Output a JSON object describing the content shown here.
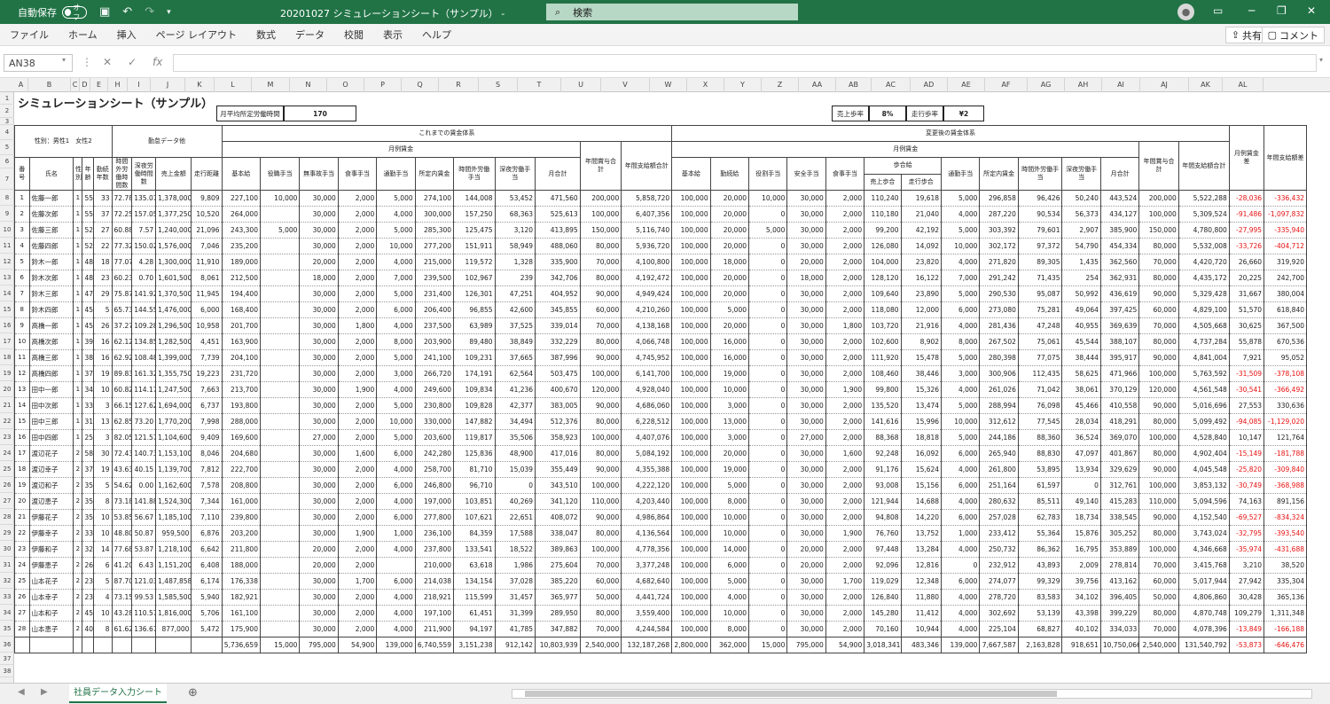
{
  "titlebar": {
    "autosave_label": "自動保存",
    "autosave_state": "オフ",
    "title": "20201027  シミュレーションシート（サンプル）  -",
    "search_placeholder": "検索"
  },
  "menu": [
    "ファイル",
    "ホーム",
    "挿入",
    "ページ レイアウト",
    "数式",
    "データ",
    "校閲",
    "表示",
    "ヘルプ"
  ],
  "share_label": "共有",
  "comment_label": "コメント",
  "namebox": "AN38",
  "columns": [
    "A",
    "B",
    "C",
    "D",
    "E",
    "H",
    "I",
    "J",
    "K",
    "L",
    "M",
    "N",
    "O",
    "P",
    "Q",
    "R",
    "S",
    "T",
    "U",
    "V",
    "W",
    "X",
    "Y",
    "Z",
    "AA",
    "AB",
    "AC",
    "AD",
    "AE",
    "AF",
    "AG",
    "AH",
    "AI",
    "AJ",
    "AK",
    "AL"
  ],
  "row_numbers": [
    "1",
    "2",
    "3",
    "4",
    "5",
    "6",
    "7",
    "8",
    "9",
    "10",
    "11",
    "12",
    "13",
    "14",
    "15",
    "16",
    "17",
    "18",
    "19",
    "20",
    "21",
    "22",
    "23",
    "24",
    "25",
    "26",
    "27",
    "28",
    "29",
    "30",
    "31",
    "32",
    "33",
    "34",
    "35",
    "36",
    "37",
    "38"
  ],
  "sheet": {
    "title": "シミュレーションシート（サンプル）",
    "monthly_hours_label": "月平均所定労働時間",
    "monthly_hours_value": "170",
    "sales_rate_label": "売上歩率",
    "sales_rate_value": "8%",
    "run_rate_label": "走行歩率",
    "run_rate_value": "¥2",
    "gender_note": "性別：男性1　女性2",
    "attendance_header": "勤怠データ他",
    "before_header": "これまでの賃金体系",
    "after_header": "変更後の賃金体系",
    "monthly_wage": "月例賃金",
    "annual_bonus": "年間賞与合計",
    "annual_pay": "年間支給額合計",
    "monthly_diff": "月例賃金差",
    "annual_diff": "年間支給額差",
    "commission": "歩合給",
    "headers_left": [
      "番号",
      "氏名",
      "性別",
      "年齢",
      "勤続年数",
      "時間外労働時間数",
      "深夜労働時間数",
      "売上金額",
      "走行距離"
    ],
    "headers_before": [
      "基本給",
      "役職手当",
      "無事故手当",
      "食事手当",
      "通勤手当",
      "所定内賃金",
      "時間外労働手当",
      "深夜労働手当",
      "月合計"
    ],
    "headers_after": [
      "基本給",
      "勤続給",
      "役割手当",
      "安全手当",
      "食事手当",
      "売上歩合",
      "走行歩合",
      "通勤手当",
      "所定内賃金",
      "時間外労働手当",
      "深夜労働手当",
      "月合計"
    ]
  },
  "rows": [
    [
      "1",
      "佐藤一郎",
      "1",
      "55",
      "33",
      "72.78",
      "135.07",
      "1,378,000",
      "9,809",
      "227,100",
      "10,000",
      "30,000",
      "2,000",
      "5,000",
      "274,100",
      "144,008",
      "53,452",
      "471,560",
      "200,000",
      "5,858,720",
      "100,000",
      "20,000",
      "10,000",
      "30,000",
      "2,000",
      "110,240",
      "19,618",
      "5,000",
      "296,858",
      "96,426",
      "50,240",
      "443,524",
      "200,000",
      "5,522,288",
      "-28,036",
      "-336,432"
    ],
    [
      "2",
      "佐藤次郎",
      "1",
      "55",
      "37",
      "72.25",
      "157.05",
      "1,377,250",
      "10,520",
      "264,000",
      "",
      "30,000",
      "2,000",
      "4,000",
      "300,000",
      "157,250",
      "68,363",
      "525,613",
      "100,000",
      "6,407,356",
      "100,000",
      "20,000",
      "0",
      "30,000",
      "2,000",
      "110,180",
      "21,040",
      "4,000",
      "287,220",
      "90,534",
      "56,373",
      "434,127",
      "100,000",
      "5,309,524",
      "-91,486",
      "-1,097,832"
    ],
    [
      "3",
      "佐藤三郎",
      "1",
      "52",
      "27",
      "60.88",
      "7.57",
      "1,240,000",
      "21,096",
      "243,300",
      "5,000",
      "30,000",
      "2,000",
      "5,000",
      "285,300",
      "125,475",
      "3,120",
      "413,895",
      "150,000",
      "5,116,740",
      "100,000",
      "20,000",
      "5,000",
      "30,000",
      "2,000",
      "99,200",
      "42,192",
      "5,000",
      "303,392",
      "79,601",
      "2,907",
      "385,900",
      "150,000",
      "4,780,800",
      "-27,995",
      "-335,940"
    ],
    [
      "4",
      "佐藤四郎",
      "1",
      "52",
      "22",
      "77.32",
      "150.02",
      "1,576,000",
      "7,046",
      "235,200",
      "",
      "30,000",
      "2,000",
      "10,000",
      "277,200",
      "151,911",
      "58,949",
      "488,060",
      "80,000",
      "5,936,720",
      "100,000",
      "20,000",
      "0",
      "30,000",
      "2,000",
      "126,080",
      "14,092",
      "10,000",
      "302,172",
      "97,372",
      "54,790",
      "454,334",
      "80,000",
      "5,532,008",
      "-33,726",
      "-404,712"
    ],
    [
      "5",
      "鈴木一郎",
      "1",
      "48",
      "18",
      "77.07",
      "4.28",
      "1,300,000",
      "11,910",
      "189,000",
      "",
      "20,000",
      "2,000",
      "4,000",
      "215,000",
      "119,572",
      "1,328",
      "335,900",
      "70,000",
      "4,100,800",
      "100,000",
      "18,000",
      "0",
      "20,000",
      "2,000",
      "104,000",
      "23,820",
      "4,000",
      "271,820",
      "89,305",
      "1,435",
      "362,560",
      "70,000",
      "4,420,720",
      "26,660",
      "319,920"
    ],
    [
      "6",
      "鈴木次郎",
      "1",
      "48",
      "23",
      "60.23",
      "0.70",
      "1,601,500",
      "8,061",
      "212,500",
      "",
      "18,000",
      "2,000",
      "7,000",
      "239,500",
      "102,967",
      "239",
      "342,706",
      "80,000",
      "4,192,472",
      "100,000",
      "20,000",
      "0",
      "18,000",
      "2,000",
      "128,120",
      "16,122",
      "7,000",
      "291,242",
      "71,435",
      "254",
      "362,931",
      "80,000",
      "4,435,172",
      "20,225",
      "242,700"
    ],
    [
      "7",
      "鈴木三郎",
      "1",
      "47",
      "29",
      "75.87",
      "141.92",
      "1,370,500",
      "11,945",
      "194,400",
      "",
      "30,000",
      "2,000",
      "5,000",
      "231,400",
      "126,301",
      "47,251",
      "404,952",
      "90,000",
      "4,949,424",
      "100,000",
      "20,000",
      "0",
      "30,000",
      "2,000",
      "109,640",
      "23,890",
      "5,000",
      "290,530",
      "95,087",
      "50,992",
      "436,619",
      "90,000",
      "5,329,428",
      "31,667",
      "380,004"
    ],
    [
      "8",
      "鈴木四郎",
      "1",
      "45",
      "5",
      "65.73",
      "144.55",
      "1,476,000",
      "6,000",
      "168,400",
      "",
      "30,000",
      "2,000",
      "6,000",
      "206,400",
      "96,855",
      "42,600",
      "345,855",
      "60,000",
      "4,210,260",
      "100,000",
      "5,000",
      "0",
      "30,000",
      "2,000",
      "118,080",
      "12,000",
      "6,000",
      "273,080",
      "75,281",
      "49,064",
      "397,425",
      "60,000",
      "4,829,100",
      "51,570",
      "618,840"
    ],
    [
      "9",
      "高橋一郎",
      "1",
      "45",
      "26",
      "37.27",
      "109.28",
      "1,296,500",
      "10,958",
      "201,700",
      "",
      "30,000",
      "1,800",
      "4,000",
      "237,500",
      "63,989",
      "37,525",
      "339,014",
      "70,000",
      "4,138,168",
      "100,000",
      "20,000",
      "0",
      "30,000",
      "1,800",
      "103,720",
      "21,916",
      "4,000",
      "281,436",
      "47,248",
      "40,955",
      "369,639",
      "70,000",
      "4,505,668",
      "30,625",
      "367,500"
    ],
    [
      "10",
      "高橋次郎",
      "1",
      "39",
      "16",
      "62.12",
      "134.85",
      "1,282,500",
      "4,451",
      "163,900",
      "",
      "30,000",
      "2,000",
      "8,000",
      "203,900",
      "89,480",
      "38,849",
      "332,229",
      "80,000",
      "4,066,748",
      "100,000",
      "16,000",
      "0",
      "30,000",
      "2,000",
      "102,600",
      "8,902",
      "8,000",
      "267,502",
      "75,061",
      "45,544",
      "388,107",
      "80,000",
      "4,737,284",
      "55,878",
      "670,536"
    ],
    [
      "11",
      "高橋三郎",
      "1",
      "38",
      "16",
      "62.92",
      "108.48",
      "1,399,000",
      "7,739",
      "204,100",
      "",
      "30,000",
      "2,000",
      "5,000",
      "241,100",
      "109,231",
      "37,665",
      "387,996",
      "90,000",
      "4,745,952",
      "100,000",
      "16,000",
      "0",
      "30,000",
      "2,000",
      "111,920",
      "15,478",
      "5,000",
      "280,398",
      "77,075",
      "38,444",
      "395,917",
      "90,000",
      "4,841,004",
      "7,921",
      "95,052"
    ],
    [
      "12",
      "高橋四郎",
      "1",
      "37",
      "19",
      "89.83",
      "161.32",
      "1,355,750",
      "19,223",
      "231,720",
      "",
      "30,000",
      "2,000",
      "3,000",
      "266,720",
      "174,191",
      "62,564",
      "503,475",
      "100,000",
      "6,141,700",
      "100,000",
      "19,000",
      "0",
      "30,000",
      "2,000",
      "108,460",
      "38,446",
      "3,000",
      "300,906",
      "112,435",
      "58,625",
      "471,966",
      "100,000",
      "5,763,592",
      "-31,509",
      "-378,108"
    ],
    [
      "13",
      "田中一郎",
      "1",
      "34",
      "10",
      "60.82",
      "114.17",
      "1,247,500",
      "7,663",
      "213,700",
      "",
      "30,000",
      "1,900",
      "4,000",
      "249,600",
      "109,834",
      "41,236",
      "400,670",
      "120,000",
      "4,928,040",
      "100,000",
      "10,000",
      "0",
      "30,000",
      "1,900",
      "99,800",
      "15,326",
      "4,000",
      "261,026",
      "71,042",
      "38,061",
      "370,129",
      "120,000",
      "4,561,548",
      "-30,541",
      "-366,492"
    ],
    [
      "14",
      "田中次郎",
      "1",
      "33",
      "3",
      "66.15",
      "127.62",
      "1,694,000",
      "6,737",
      "193,800",
      "",
      "30,000",
      "2,000",
      "5,000",
      "230,800",
      "109,828",
      "42,377",
      "383,005",
      "90,000",
      "4,686,060",
      "100,000",
      "3,000",
      "0",
      "30,000",
      "2,000",
      "135,520",
      "13,474",
      "5,000",
      "288,994",
      "76,098",
      "45,466",
      "410,558",
      "90,000",
      "5,016,696",
      "27,553",
      "330,636"
    ],
    [
      "15",
      "田中三郎",
      "1",
      "31",
      "13",
      "62.85",
      "73.20",
      "1,770,200",
      "7,998",
      "288,000",
      "",
      "30,000",
      "2,000",
      "10,000",
      "330,000",
      "147,882",
      "34,494",
      "512,376",
      "80,000",
      "6,228,512",
      "100,000",
      "13,000",
      "0",
      "30,000",
      "2,000",
      "141,616",
      "15,996",
      "10,000",
      "312,612",
      "77,545",
      "28,034",
      "418,291",
      "80,000",
      "5,099,492",
      "-94,085",
      "-1,129,020"
    ],
    [
      "16",
      "田中四郎",
      "1",
      "25",
      "3",
      "82.05",
      "121.57",
      "1,104,600",
      "9,409",
      "169,600",
      "",
      "27,000",
      "2,000",
      "5,000",
      "203,600",
      "119,817",
      "35,506",
      "358,923",
      "100,000",
      "4,407,076",
      "100,000",
      "3,000",
      "0",
      "27,000",
      "2,000",
      "88,368",
      "18,818",
      "5,000",
      "244,186",
      "88,360",
      "36,524",
      "369,070",
      "100,000",
      "4,528,840",
      "10,147",
      "121,764"
    ],
    [
      "17",
      "渡辺花子",
      "2",
      "58",
      "30",
      "72.43",
      "140.73",
      "1,153,100",
      "8,046",
      "204,680",
      "",
      "30,000",
      "1,600",
      "6,000",
      "242,280",
      "125,836",
      "48,900",
      "417,016",
      "80,000",
      "5,084,192",
      "100,000",
      "20,000",
      "0",
      "30,000",
      "1,600",
      "92,248",
      "16,092",
      "6,000",
      "265,940",
      "88,830",
      "47,097",
      "401,867",
      "80,000",
      "4,902,404",
      "-15,149",
      "-181,788"
    ],
    [
      "18",
      "渡辺幸子",
      "2",
      "37",
      "19",
      "43.63",
      "40.15",
      "1,139,700",
      "7,812",
      "222,700",
      "",
      "30,000",
      "2,000",
      "4,000",
      "258,700",
      "81,710",
      "15,039",
      "355,449",
      "90,000",
      "4,355,388",
      "100,000",
      "19,000",
      "0",
      "30,000",
      "2,000",
      "91,176",
      "15,624",
      "4,000",
      "261,800",
      "53,895",
      "13,934",
      "329,629",
      "90,000",
      "4,045,548",
      "-25,820",
      "-309,840"
    ],
    [
      "19",
      "渡辺和子",
      "2",
      "35",
      "5",
      "54.62",
      "0.00",
      "1,162,600",
      "7,578",
      "208,800",
      "",
      "30,000",
      "2,000",
      "6,000",
      "246,800",
      "96,710",
      "0",
      "343,510",
      "100,000",
      "4,222,120",
      "100,000",
      "5,000",
      "0",
      "30,000",
      "2,000",
      "93,008",
      "15,156",
      "6,000",
      "251,164",
      "61,597",
      "0",
      "312,761",
      "100,000",
      "3,853,132",
      "-30,749",
      "-368,988"
    ],
    [
      "20",
      "渡辺恵子",
      "2",
      "35",
      "8",
      "73.18",
      "141.88",
      "1,524,300",
      "7,344",
      "161,000",
      "",
      "30,000",
      "2,000",
      "4,000",
      "197,000",
      "103,851",
      "40,269",
      "341,120",
      "110,000",
      "4,203,440",
      "100,000",
      "8,000",
      "0",
      "30,000",
      "2,000",
      "121,944",
      "14,688",
      "4,000",
      "280,632",
      "85,511",
      "49,140",
      "415,283",
      "110,000",
      "5,094,596",
      "74,163",
      "891,156"
    ],
    [
      "21",
      "伊藤花子",
      "2",
      "35",
      "10",
      "53.85",
      "56.67",
      "1,185,100",
      "7,110",
      "239,800",
      "",
      "30,000",
      "2,000",
      "6,000",
      "277,800",
      "107,621",
      "22,651",
      "408,072",
      "90,000",
      "4,986,864",
      "100,000",
      "10,000",
      "0",
      "30,000",
      "2,000",
      "94,808",
      "14,220",
      "6,000",
      "257,028",
      "62,783",
      "18,734",
      "338,545",
      "90,000",
      "4,152,540",
      "-69,527",
      "-834,324"
    ],
    [
      "22",
      "伊藤幸子",
      "2",
      "33",
      "10",
      "48.80",
      "50.87",
      "959,500",
      "6,876",
      "203,200",
      "",
      "30,000",
      "1,900",
      "1,000",
      "236,100",
      "84,359",
      "17,588",
      "338,047",
      "80,000",
      "4,136,564",
      "100,000",
      "10,000",
      "0",
      "30,000",
      "1,900",
      "76,760",
      "13,752",
      "1,000",
      "233,412",
      "55,364",
      "15,876",
      "305,252",
      "80,000",
      "3,743,024",
      "-32,795",
      "-393,540"
    ],
    [
      "23",
      "伊藤和子",
      "2",
      "32",
      "14",
      "77.68",
      "53.87",
      "1,218,100",
      "6,642",
      "211,800",
      "",
      "20,000",
      "2,000",
      "4,000",
      "237,800",
      "133,541",
      "18,522",
      "389,863",
      "100,000",
      "4,778,356",
      "100,000",
      "14,000",
      "0",
      "20,000",
      "2,000",
      "97,448",
      "13,284",
      "4,000",
      "250,732",
      "86,362",
      "16,795",
      "353,889",
      "100,000",
      "4,346,668",
      "-35,974",
      "-431,688"
    ],
    [
      "24",
      "伊藤恵子",
      "2",
      "26",
      "6",
      "41.20",
      "6.43",
      "1,151,200",
      "6,408",
      "188,000",
      "",
      "20,000",
      "2,000",
      "",
      "210,000",
      "63,618",
      "1,986",
      "275,604",
      "70,000",
      "3,377,248",
      "100,000",
      "6,000",
      "0",
      "20,000",
      "2,000",
      "92,096",
      "12,816",
      "0",
      "232,912",
      "43,893",
      "2,009",
      "278,814",
      "70,000",
      "3,415,768",
      "3,210",
      "38,520"
    ],
    [
      "25",
      "山本花子",
      "2",
      "23",
      "5",
      "87.70",
      "121.03",
      "1,487,858",
      "6,174",
      "176,338",
      "",
      "30,000",
      "1,700",
      "6,000",
      "214,038",
      "134,154",
      "37,028",
      "385,220",
      "60,000",
      "4,682,640",
      "100,000",
      "5,000",
      "0",
      "30,000",
      "1,700",
      "119,029",
      "12,348",
      "6,000",
      "274,077",
      "99,329",
      "39,756",
      "413,162",
      "60,000",
      "5,017,944",
      "27,942",
      "335,304"
    ],
    [
      "26",
      "山本幸子",
      "2",
      "23",
      "4",
      "73.15",
      "99.53",
      "1,585,500",
      "5,940",
      "182,921",
      "",
      "30,000",
      "2,000",
      "4,000",
      "218,921",
      "115,599",
      "31,457",
      "365,977",
      "50,000",
      "4,441,724",
      "100,000",
      "4,000",
      "0",
      "30,000",
      "2,000",
      "126,840",
      "11,880",
      "4,000",
      "278,720",
      "83,583",
      "34,102",
      "396,405",
      "50,000",
      "4,806,860",
      "30,428",
      "365,136"
    ],
    [
      "27",
      "山本和子",
      "2",
      "45",
      "10",
      "43.28",
      "110.57",
      "1,816,000",
      "5,706",
      "161,100",
      "",
      "30,000",
      "2,000",
      "4,000",
      "197,100",
      "61,451",
      "31,399",
      "289,950",
      "80,000",
      "3,559,400",
      "100,000",
      "10,000",
      "0",
      "30,000",
      "2,000",
      "145,280",
      "11,412",
      "4,000",
      "302,692",
      "53,139",
      "43,398",
      "399,229",
      "80,000",
      "4,870,748",
      "109,279",
      "1,311,348"
    ],
    [
      "28",
      "山本恵子",
      "2",
      "40",
      "8",
      "61.62",
      "136.67",
      "877,000",
      "5,472",
      "175,900",
      "",
      "30,000",
      "2,000",
      "4,000",
      "211,900",
      "94,197",
      "41,785",
      "347,882",
      "70,000",
      "4,244,584",
      "100,000",
      "8,000",
      "0",
      "30,000",
      "2,000",
      "70,160",
      "10,944",
      "4,000",
      "225,104",
      "68,827",
      "40,102",
      "334,033",
      "70,000",
      "4,078,396",
      "-13,849",
      "-166,188"
    ]
  ],
  "totals": [
    "5,736,659",
    "15,000",
    "795,000",
    "54,900",
    "139,000",
    "6,740,559",
    "3,151,238",
    "912,142",
    "10,803,939",
    "2,540,000",
    "132,187,268",
    "2,800,000",
    "362,000",
    "15,000",
    "795,000",
    "54,900",
    "3,018,341",
    "483,346",
    "139,000",
    "7,667,587",
    "2,163,828",
    "918,651",
    "10,750,066",
    "2,540,000",
    "131,540,792",
    "-53,873",
    "-646,476"
  ],
  "sheet_tab": "社員データ入力シート"
}
